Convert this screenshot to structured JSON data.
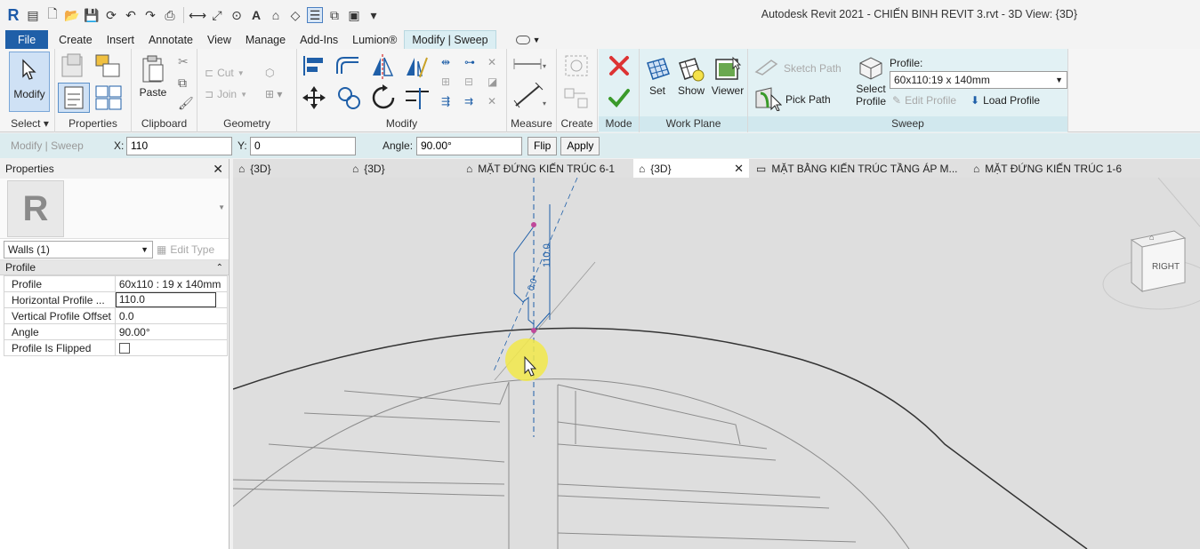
{
  "titlebar": {
    "title": "Autodesk Revit 2021 - CHIẾN BINH REVIT 3.rvt - 3D View: {3D}"
  },
  "tabs": [
    {
      "label": "File"
    },
    {
      "label": "Create"
    },
    {
      "label": "Insert"
    },
    {
      "label": "Annotate"
    },
    {
      "label": "View"
    },
    {
      "label": "Manage"
    },
    {
      "label": "Add-Ins"
    },
    {
      "label": "Lumion®"
    },
    {
      "label": "Modify | Sweep"
    }
  ],
  "ribbon": {
    "select": {
      "modify_label": "Modify",
      "panel_label": "Select"
    },
    "properties": {
      "panel_label": "Properties"
    },
    "clipboard": {
      "paste_label": "Paste",
      "panel_label": "Clipboard"
    },
    "geometry": {
      "cut_label": "Cut",
      "join_label": "Join",
      "panel_label": "Geometry"
    },
    "modify": {
      "panel_label": "Modify"
    },
    "measure": {
      "panel_label": "Measure"
    },
    "create": {
      "panel_label": "Create"
    },
    "mode": {
      "panel_label": "Mode"
    },
    "work_plane": {
      "set_label": "Set",
      "show_label": "Show",
      "viewer_label": "Viewer",
      "panel_label": "Work Plane"
    },
    "sweep": {
      "sketch_path_label": "Sketch Path",
      "pick_path_label": "Pick Path",
      "select_profile_label_1": "Select",
      "select_profile_label_2": "Profile",
      "profile_label": "Profile:",
      "profile_value": "60x110:19 x 140mm",
      "edit_profile_label": "Edit Profile",
      "load_profile_label": "Load Profile",
      "panel_label": "Sweep"
    }
  },
  "options_bar": {
    "context_label": "Modify | Sweep",
    "x_label": "X:",
    "x_value": "110",
    "y_label": "Y:",
    "y_value": "0",
    "angle_label": "Angle:",
    "angle_value": "90.00°",
    "flip_label": "Flip",
    "apply_label": "Apply"
  },
  "properties": {
    "title": "Properties",
    "type_selector": "Walls (1)",
    "edit_type_label": "Edit Type",
    "group_label": "Profile",
    "rows": [
      {
        "name": "Profile",
        "value": "60x110 : 19 x 140mm"
      },
      {
        "name": "Horizontal Profile ...",
        "value": "110.0"
      },
      {
        "name": "Vertical Profile Offset",
        "value": "0.0"
      },
      {
        "name": "Angle",
        "value": "90.00°"
      },
      {
        "name": "Profile Is Flipped",
        "value": ""
      }
    ]
  },
  "view_tabs": [
    {
      "label": "{3D}"
    },
    {
      "label": "{3D}"
    },
    {
      "label": "MẶT ĐỨNG KIẾN TRÚC 6-1"
    },
    {
      "label": "{3D}"
    },
    {
      "label": "MẶT BẰNG KIẾN TRÚC TẦNG ÁP M..."
    },
    {
      "label": "MẶT ĐỨNG KIẾN TRÚC 1-6"
    }
  ],
  "viewport": {
    "dimension_text": "110.0",
    "dimension_text_2": "0.0",
    "viewcube_label": "RIGHT"
  }
}
